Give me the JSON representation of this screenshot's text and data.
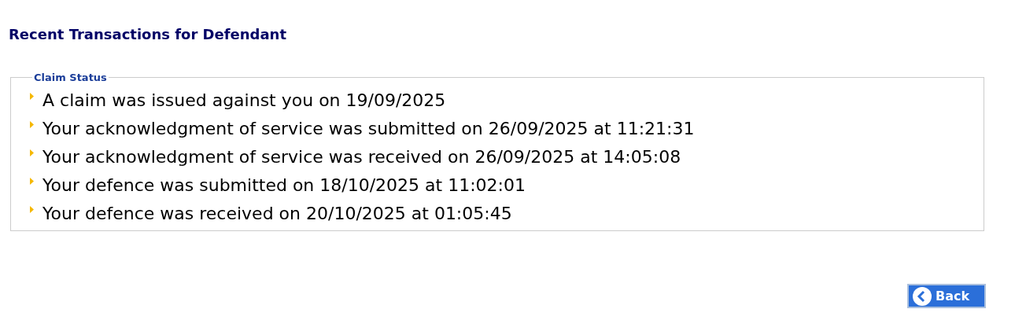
{
  "heading": "Recent Transactions for Defendant",
  "claim_status": {
    "legend": "Claim Status",
    "items": [
      "A claim was issued against you on 19/09/2025",
      "Your acknowledgment of service was submitted on 26/09/2025 at 11:21:31",
      "Your acknowledgment of service was received on 26/09/2025 at 14:05:08",
      "Your defence was submitted on 18/10/2025 at 11:02:01",
      "Your defence was received on 20/10/2025 at 01:05:45"
    ]
  },
  "back_button": {
    "label": "Back"
  }
}
